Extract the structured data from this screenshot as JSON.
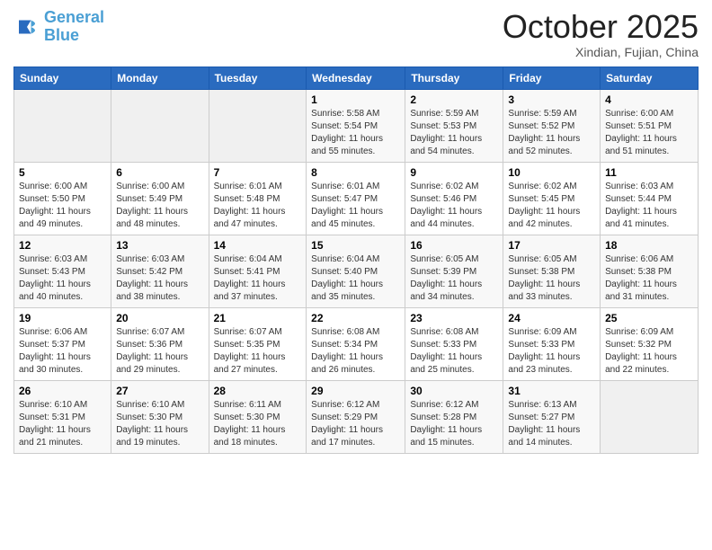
{
  "header": {
    "logo_line1": "General",
    "logo_line2": "Blue",
    "month": "October 2025",
    "location": "Xindian, Fujian, China"
  },
  "weekdays": [
    "Sunday",
    "Monday",
    "Tuesday",
    "Wednesday",
    "Thursday",
    "Friday",
    "Saturday"
  ],
  "weeks": [
    [
      {
        "day": "",
        "info": ""
      },
      {
        "day": "",
        "info": ""
      },
      {
        "day": "",
        "info": ""
      },
      {
        "day": "1",
        "info": "Sunrise: 5:58 AM\nSunset: 5:54 PM\nDaylight: 11 hours\nand 55 minutes."
      },
      {
        "day": "2",
        "info": "Sunrise: 5:59 AM\nSunset: 5:53 PM\nDaylight: 11 hours\nand 54 minutes."
      },
      {
        "day": "3",
        "info": "Sunrise: 5:59 AM\nSunset: 5:52 PM\nDaylight: 11 hours\nand 52 minutes."
      },
      {
        "day": "4",
        "info": "Sunrise: 6:00 AM\nSunset: 5:51 PM\nDaylight: 11 hours\nand 51 minutes."
      }
    ],
    [
      {
        "day": "5",
        "info": "Sunrise: 6:00 AM\nSunset: 5:50 PM\nDaylight: 11 hours\nand 49 minutes."
      },
      {
        "day": "6",
        "info": "Sunrise: 6:00 AM\nSunset: 5:49 PM\nDaylight: 11 hours\nand 48 minutes."
      },
      {
        "day": "7",
        "info": "Sunrise: 6:01 AM\nSunset: 5:48 PM\nDaylight: 11 hours\nand 47 minutes."
      },
      {
        "day": "8",
        "info": "Sunrise: 6:01 AM\nSunset: 5:47 PM\nDaylight: 11 hours\nand 45 minutes."
      },
      {
        "day": "9",
        "info": "Sunrise: 6:02 AM\nSunset: 5:46 PM\nDaylight: 11 hours\nand 44 minutes."
      },
      {
        "day": "10",
        "info": "Sunrise: 6:02 AM\nSunset: 5:45 PM\nDaylight: 11 hours\nand 42 minutes."
      },
      {
        "day": "11",
        "info": "Sunrise: 6:03 AM\nSunset: 5:44 PM\nDaylight: 11 hours\nand 41 minutes."
      }
    ],
    [
      {
        "day": "12",
        "info": "Sunrise: 6:03 AM\nSunset: 5:43 PM\nDaylight: 11 hours\nand 40 minutes."
      },
      {
        "day": "13",
        "info": "Sunrise: 6:03 AM\nSunset: 5:42 PM\nDaylight: 11 hours\nand 38 minutes."
      },
      {
        "day": "14",
        "info": "Sunrise: 6:04 AM\nSunset: 5:41 PM\nDaylight: 11 hours\nand 37 minutes."
      },
      {
        "day": "15",
        "info": "Sunrise: 6:04 AM\nSunset: 5:40 PM\nDaylight: 11 hours\nand 35 minutes."
      },
      {
        "day": "16",
        "info": "Sunrise: 6:05 AM\nSunset: 5:39 PM\nDaylight: 11 hours\nand 34 minutes."
      },
      {
        "day": "17",
        "info": "Sunrise: 6:05 AM\nSunset: 5:38 PM\nDaylight: 11 hours\nand 33 minutes."
      },
      {
        "day": "18",
        "info": "Sunrise: 6:06 AM\nSunset: 5:38 PM\nDaylight: 11 hours\nand 31 minutes."
      }
    ],
    [
      {
        "day": "19",
        "info": "Sunrise: 6:06 AM\nSunset: 5:37 PM\nDaylight: 11 hours\nand 30 minutes."
      },
      {
        "day": "20",
        "info": "Sunrise: 6:07 AM\nSunset: 5:36 PM\nDaylight: 11 hours\nand 29 minutes."
      },
      {
        "day": "21",
        "info": "Sunrise: 6:07 AM\nSunset: 5:35 PM\nDaylight: 11 hours\nand 27 minutes."
      },
      {
        "day": "22",
        "info": "Sunrise: 6:08 AM\nSunset: 5:34 PM\nDaylight: 11 hours\nand 26 minutes."
      },
      {
        "day": "23",
        "info": "Sunrise: 6:08 AM\nSunset: 5:33 PM\nDaylight: 11 hours\nand 25 minutes."
      },
      {
        "day": "24",
        "info": "Sunrise: 6:09 AM\nSunset: 5:33 PM\nDaylight: 11 hours\nand 23 minutes."
      },
      {
        "day": "25",
        "info": "Sunrise: 6:09 AM\nSunset: 5:32 PM\nDaylight: 11 hours\nand 22 minutes."
      }
    ],
    [
      {
        "day": "26",
        "info": "Sunrise: 6:10 AM\nSunset: 5:31 PM\nDaylight: 11 hours\nand 21 minutes."
      },
      {
        "day": "27",
        "info": "Sunrise: 6:10 AM\nSunset: 5:30 PM\nDaylight: 11 hours\nand 19 minutes."
      },
      {
        "day": "28",
        "info": "Sunrise: 6:11 AM\nSunset: 5:30 PM\nDaylight: 11 hours\nand 18 minutes."
      },
      {
        "day": "29",
        "info": "Sunrise: 6:12 AM\nSunset: 5:29 PM\nDaylight: 11 hours\nand 17 minutes."
      },
      {
        "day": "30",
        "info": "Sunrise: 6:12 AM\nSunset: 5:28 PM\nDaylight: 11 hours\nand 15 minutes."
      },
      {
        "day": "31",
        "info": "Sunrise: 6:13 AM\nSunset: 5:27 PM\nDaylight: 11 hours\nand 14 minutes."
      },
      {
        "day": "",
        "info": ""
      }
    ]
  ]
}
